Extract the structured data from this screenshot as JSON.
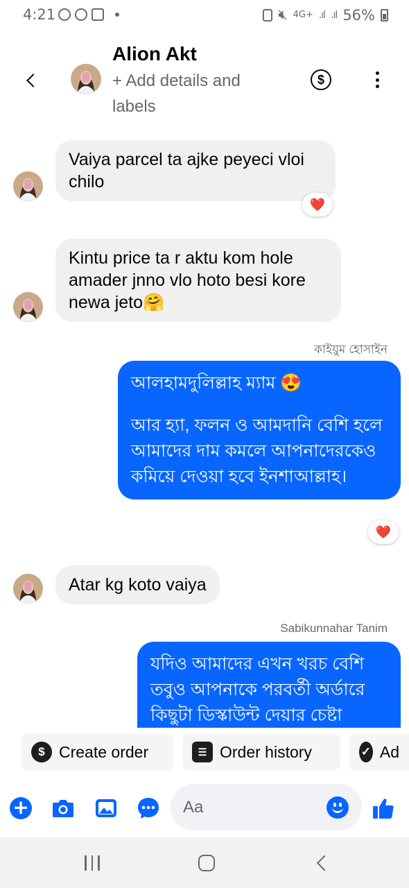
{
  "status_bar": {
    "time": "4:21",
    "network": "4G+",
    "battery": "56%"
  },
  "header": {
    "contact_name": "Alion Akt",
    "add_details": "+ Add details and labels",
    "dollar_icon": "$"
  },
  "messages": [
    {
      "direction": "incoming",
      "text": "Vaiya parcel ta ajke peyeci vloi chilo",
      "reaction": "❤️"
    },
    {
      "direction": "incoming",
      "text": "Kintu price ta r aktu kom hole amader jnno vlo hoto besi kore newa jeto🤗"
    },
    {
      "direction": "outgoing",
      "sender": "কাইয়ুম হোসাইন",
      "text_line1": "আলহামদুলিল্লাহ ম্যাম 😍",
      "text_line2": "আর হ্যা, ফলন ও আমদানি বেশি হলে আমাদের দাম কমলে আপনাদেরকেও কমিয়ে দেওয়া হবে ইনশাআল্লাহ।",
      "reaction": "❤️"
    },
    {
      "direction": "incoming",
      "text": "Atar kg koto vaiya"
    },
    {
      "direction": "outgoing",
      "sender": "Sabikunnahar Tanim",
      "text": "যদিও আমাদের এখন খরচ বেশি তবুও আপনাকে পরবর্তী অর্ডারে কিছুটা ডিস্কাউন্ট দেয়ার চেষ্টা"
    }
  ],
  "quick_actions": [
    {
      "label": "Create order",
      "icon": "dollar-icon"
    },
    {
      "label": "Order history",
      "icon": "list-icon"
    },
    {
      "label": "Ad",
      "icon": "check-icon"
    }
  ],
  "composer": {
    "placeholder": "Aa"
  },
  "colors": {
    "accent": "#0866ff",
    "incoming_bubble": "#f0f0f0",
    "heart": "#e41e3f"
  }
}
